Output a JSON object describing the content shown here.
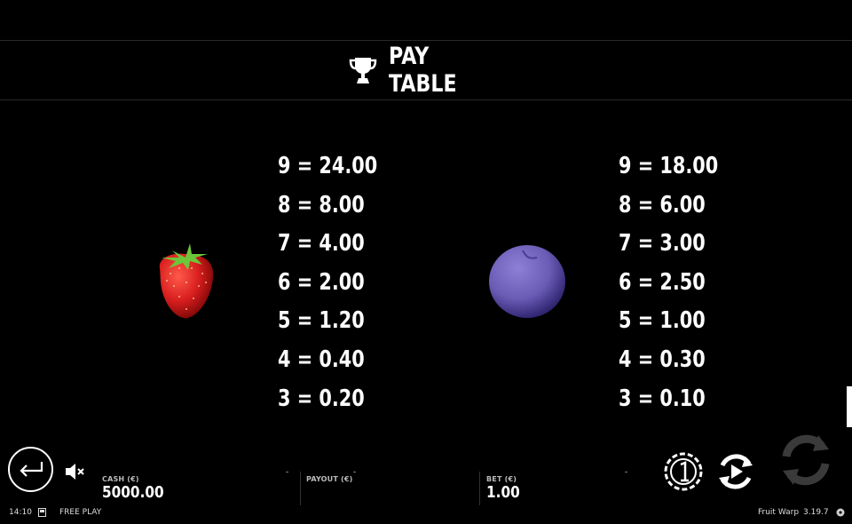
{
  "pay_table": {
    "title": "PAY TABLE",
    "title_icon": "trophy-icon",
    "symbols": [
      {
        "symbol": "strawberry",
        "colors": {
          "body": "#d81e1e",
          "leaf": "#6cc63a"
        },
        "payouts": [
          "9 = 24.00",
          "8 = 8.00",
          "7 = 4.00",
          "6 = 2.00",
          "5 = 1.20",
          "4 = 0.40",
          "3 = 0.20"
        ]
      },
      {
        "symbol": "plum",
        "colors": {
          "body": "#6a5bb5"
        },
        "payouts": [
          "9 = 18.00",
          "8 = 6.00",
          "7 = 3.00",
          "6 = 2.50",
          "5 = 1.00",
          "4 = 0.30",
          "3 = 0.10"
        ]
      }
    ]
  },
  "bottom_bar": {
    "back_icon": "back-arrow-icon",
    "mute_icon": "speaker-muted-icon",
    "cash": {
      "label": "CASH (€)",
      "value": "5000.00"
    },
    "payout": {
      "label": "PAYOUT (€)",
      "value": ""
    },
    "bet": {
      "label": "BET (€)",
      "value": "1.00"
    },
    "coin_icon": "coin-value-icon",
    "autoplay_icon": "autoplay-icon",
    "spin_icon": "spin-icon"
  },
  "footer": {
    "time": "14:10",
    "mode_icon": "history-icon",
    "mode": "FREE PLAY",
    "game_name": "Fruit Warp",
    "version": "3.19.7",
    "settings_icon": "settings-icon"
  }
}
